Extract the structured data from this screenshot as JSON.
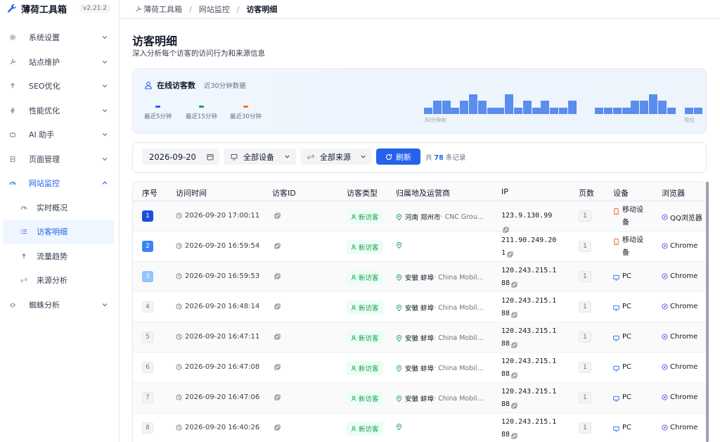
{
  "app": {
    "title": "薄荷工具箱",
    "version": "v2.21.2"
  },
  "sidebar": {
    "items": [
      {
        "label": "系统设置",
        "icon": "gear-icon"
      },
      {
        "label": "站点维护",
        "icon": "wrench-icon"
      },
      {
        "label": "SEO优化",
        "icon": "arrow-up-icon"
      },
      {
        "label": "性能优化",
        "icon": "bolt-icon"
      },
      {
        "label": "AI 助手",
        "icon": "robot-icon"
      },
      {
        "label": "页面管理",
        "icon": "page-icon"
      },
      {
        "label": "网站监控",
        "icon": "gauge-icon"
      }
    ],
    "sub_items": [
      {
        "label": "实时概况",
        "icon": "gauge-icon"
      },
      {
        "label": "访客明细",
        "icon": "list-icon"
      },
      {
        "label": "流量趋势",
        "icon": "arrow-up-icon"
      },
      {
        "label": "来源分析",
        "icon": "link-icon"
      }
    ],
    "last_item": {
      "label": "蜘蛛分析",
      "icon": "bug-icon"
    }
  },
  "breadcrumb": {
    "root": "薄荷工具箱",
    "parent": "网站监控",
    "current": "访客明细"
  },
  "page": {
    "title": "访客明细",
    "subtitle": "深入分析每个访客的访问行为和来源信息"
  },
  "online": {
    "label": "在线访客数",
    "hint": "近30分钟数据",
    "stats": [
      {
        "label": "最近5分钟",
        "color": "#2563eb"
      },
      {
        "label": "最近15分钟",
        "color": "#16a34a"
      },
      {
        "label": "最近30分钟",
        "color": "#f97316"
      }
    ],
    "chart_start": "30分钟前",
    "chart_end": "现在",
    "chart_values": [
      1,
      2,
      2,
      1,
      2,
      3,
      2,
      1,
      1,
      3,
      1,
      2,
      1,
      2,
      1,
      1,
      2,
      0,
      0,
      1,
      1,
      1,
      1,
      2,
      2,
      3,
      2,
      1,
      0,
      1,
      1
    ]
  },
  "filters": {
    "date": "2026-09-20",
    "device": "全部设备",
    "source": "全部来源",
    "refresh": "刷新",
    "count_prefix": "共",
    "count": "78",
    "count_suffix": "条记录"
  },
  "table": {
    "headers": [
      "序号",
      "访问时间",
      "访客ID",
      "访客类型",
      "归属地及运营商",
      "IP",
      "页数",
      "设备",
      "浏览器"
    ],
    "rows": [
      {
        "idx": "1",
        "time": "2026-09-20 17:00:11",
        "type": "新访客",
        "region": "河南 郑州市",
        "isp": " · CNC Grou...",
        "ip": "123.9.130.99",
        "pages": "1",
        "device": "移动设备",
        "device_kind": "mobile",
        "browser": "QQ浏览器"
      },
      {
        "idx": "2",
        "time": "2026-09-20 16:59:54",
        "type": "新访客",
        "region": "",
        "isp": "",
        "ip": "211.90.249.201",
        "pages": "1",
        "device": "移动设备",
        "device_kind": "mobile",
        "browser": "Chrome"
      },
      {
        "idx": "3",
        "time": "2026-09-20 16:59:53",
        "type": "新访客",
        "region": "安徽 蚌埠",
        "isp": " · China Mobil...",
        "ip": "120.243.215.188",
        "pages": "1",
        "device": "PC",
        "device_kind": "pc",
        "browser": "Chrome"
      },
      {
        "idx": "4",
        "time": "2026-09-20 16:48:14",
        "type": "新访客",
        "region": "安徽 蚌埠",
        "isp": " · China Mobil...",
        "ip": "120.243.215.188",
        "pages": "1",
        "device": "PC",
        "device_kind": "pc",
        "browser": "Chrome"
      },
      {
        "idx": "5",
        "time": "2026-09-20 16:47:11",
        "type": "新访客",
        "region": "安徽 蚌埠",
        "isp": " · China Mobil...",
        "ip": "120.243.215.188",
        "pages": "1",
        "device": "PC",
        "device_kind": "pc",
        "browser": "Chrome"
      },
      {
        "idx": "6",
        "time": "2026-09-20 16:47:08",
        "type": "新访客",
        "region": "安徽 蚌埠",
        "isp": " · China Mobil...",
        "ip": "120.243.215.188",
        "pages": "1",
        "device": "PC",
        "device_kind": "pc",
        "browser": "Chrome"
      },
      {
        "idx": "7",
        "time": "2026-09-20 16:47:06",
        "type": "新访客",
        "region": "安徽 蚌埠",
        "isp": " · China Mobil...",
        "ip": "120.243.215.188",
        "pages": "1",
        "device": "PC",
        "device_kind": "pc",
        "browser": "Chrome"
      },
      {
        "idx": "8",
        "time": "2026-09-20 16:40:26",
        "type": "新访客",
        "region": "",
        "isp": "",
        "ip": "120.243.215.188",
        "pages": "1",
        "device": "PC",
        "device_kind": "pc",
        "browser": "Chrome"
      }
    ]
  }
}
